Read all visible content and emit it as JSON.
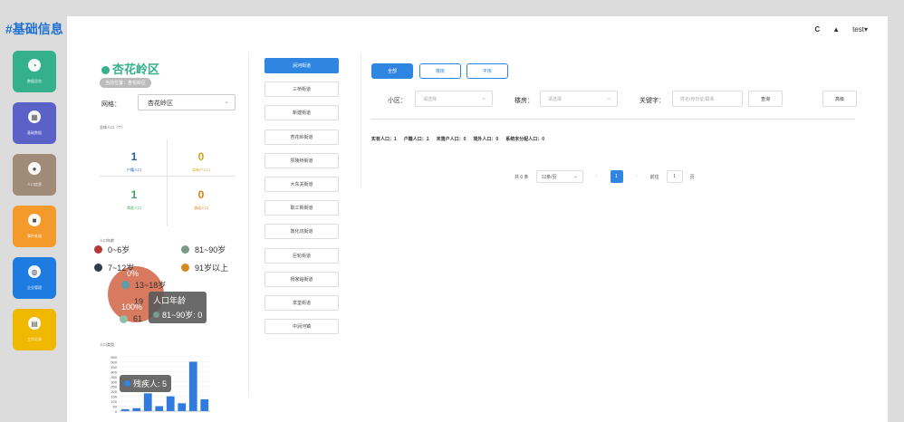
{
  "app": {
    "brand": "#基础信息"
  },
  "sidebar": {
    "items": [
      {
        "label": "数据总览",
        "icon": "dashboard-icon",
        "color": "#34b08c"
      },
      {
        "label": "基础数据",
        "icon": "grid-icon",
        "color": "#5a62c8"
      },
      {
        "label": "人口信息",
        "icon": "person-icon",
        "color": "#a08a78"
      },
      {
        "label": "事件处理",
        "icon": "lock-icon",
        "color": "#f39a2a"
      },
      {
        "label": "企业管理",
        "icon": "globe-icon",
        "color": "#1e7be0"
      },
      {
        "label": "工作记录",
        "icon": "document-icon",
        "color": "#f0b800"
      }
    ]
  },
  "header": {
    "refresh_icon": "C",
    "bell_icon": "🔔",
    "user": "test"
  },
  "left": {
    "district": "杏花岭区",
    "location": "当前位置：杏花岭区",
    "grid_label": "网格：",
    "grid_value": "杏花岭区",
    "section_overview": "总体人口（个）",
    "stats": [
      {
        "value": "1",
        "caption": "户籍人口",
        "color": "#1f5fb0"
      },
      {
        "value": "0",
        "caption": "实有户人口",
        "color": "#d4a017"
      },
      {
        "value": "1",
        "caption": "常驻人口",
        "color": "#3aa55a"
      },
      {
        "value": "0",
        "caption": "流动人口",
        "color": "#e07b10"
      }
    ],
    "section_age": "人口年龄",
    "age_legend": [
      {
        "label": "0~6岁",
        "color": "#b23a3a"
      },
      {
        "label": "81~90岁",
        "color": "#7a9a8a"
      },
      {
        "label": "7~12岁",
        "color": "#2f3e4e"
      },
      {
        "label": "91岁以上",
        "color": "#d48a20"
      },
      {
        "label": "13~18岁",
        "color": "#5aa0a8"
      },
      {
        "label": "19",
        "color": "#c8c8c8"
      },
      {
        "label": "61",
        "color": "#8fbfa8"
      }
    ],
    "pie_labels": {
      "top": "0%",
      "bottom": "100%"
    },
    "pie_tooltip": {
      "title": "人口年龄",
      "detail": "81~90岁: 0"
    },
    "section_special": "人口类型",
    "bar_tooltip": "残疾人: 5"
  },
  "chart_data": {
    "type": "bar",
    "categories": [
      "",
      "",
      "",
      "",
      "",
      "",
      "",
      ""
    ],
    "values": [
      20,
      30,
      180,
      50,
      150,
      80,
      500,
      120
    ],
    "ylim": [
      0,
      550
    ],
    "yticks": [
      "550",
      "500",
      "450",
      "400",
      "350",
      "300",
      "250",
      "200",
      "150",
      "100",
      "50",
      "0"
    ]
  },
  "streets": [
    "涧河街道",
    "三桥街道",
    "新建街道",
    "杏花岭街道",
    "坝陵桥街道",
    "大东关街道",
    "职工新街道",
    "敦化坊街道",
    "巨轮街道",
    "杨家峪街道",
    "享堂街道",
    "中涧河镇"
  ],
  "tabs": [
    "全部",
    "楼房",
    "平房"
  ],
  "filters": {
    "community_label": "小区：",
    "community_placeholder": "请选择",
    "building_label": "楼房：",
    "building_placeholder": "请选择",
    "keyword_label": "关键字：",
    "keyword_placeholder": "姓名/身份证/联系",
    "search": "查询",
    "advanced": "高级"
  },
  "summary": {
    "actual": "实有人口：1",
    "registered": "户籍人口：1",
    "unregistered": "未落户人口：0",
    "overseas": "境外人口：0",
    "unassigned": "系统未分配人口：0"
  },
  "pager": {
    "total": "共 0 条",
    "page_size": "12条/页",
    "prev": "‹",
    "current": "1",
    "next": "›",
    "goto": "前往",
    "goto_value": "1",
    "page_unit": "页"
  }
}
